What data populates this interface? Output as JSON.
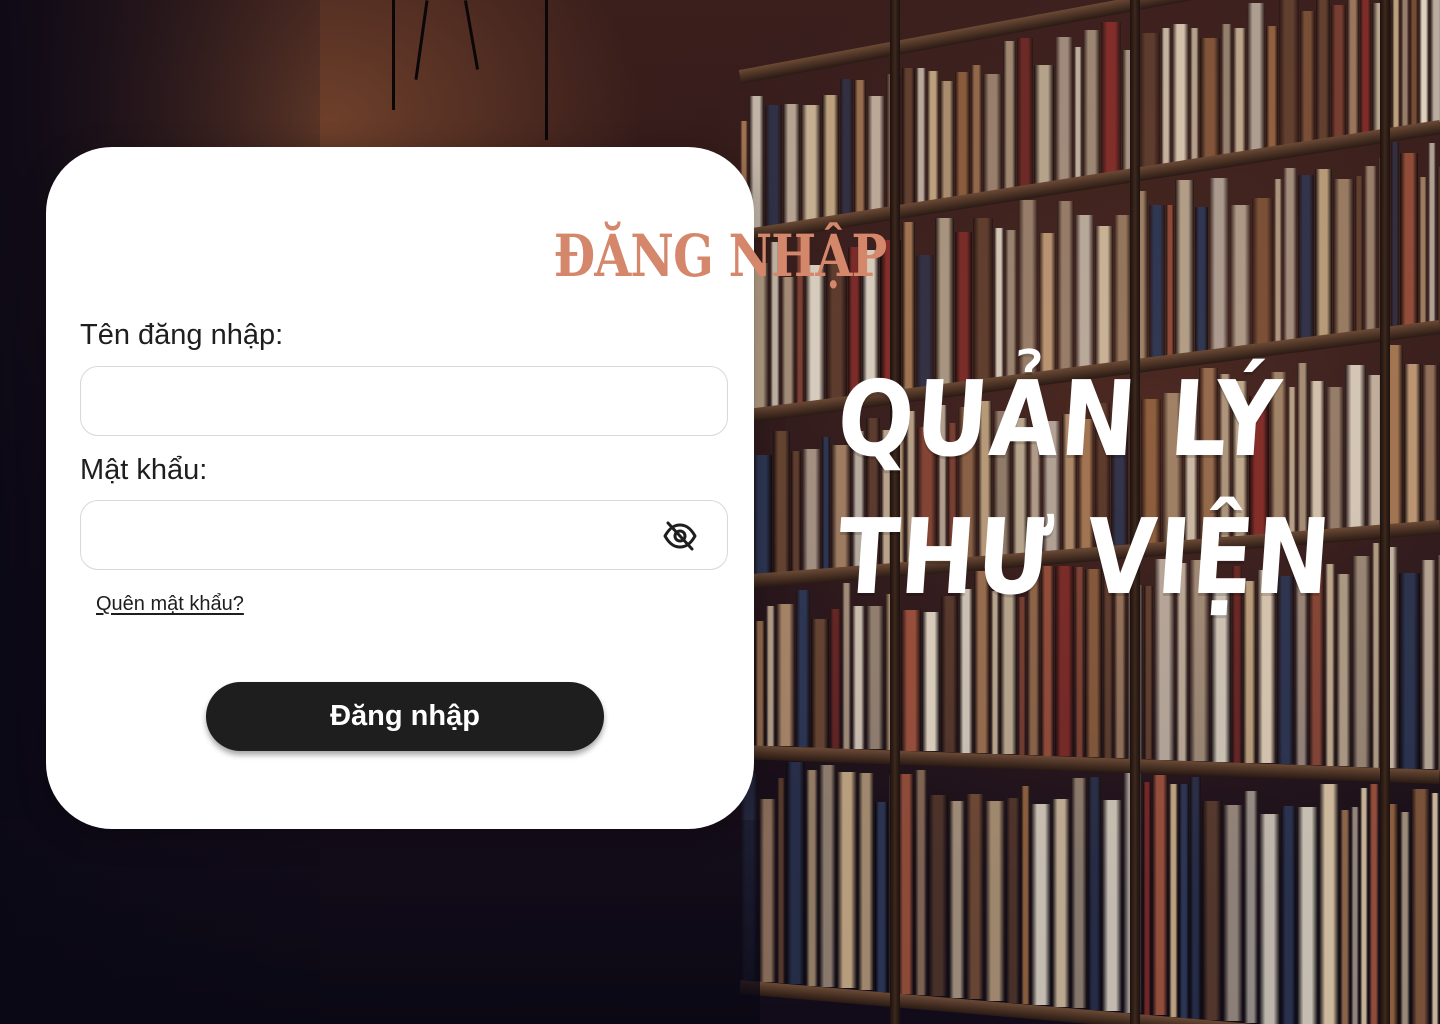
{
  "login": {
    "title": "ĐĂNG NHẬP",
    "username_label": "Tên đăng nhập:",
    "username_value": "",
    "password_label": "Mật khẩu:",
    "password_value": "",
    "toggle_icon": "eye-slash-icon",
    "forgot_password": "Quên mật khẩu?",
    "submit_label": "Đăng nhập"
  },
  "hero": {
    "line1": "QUẢN LÝ",
    "line2": "THƯ VIỆN"
  },
  "colors": {
    "title_accent": "#d4876a",
    "button_bg": "#1e1e1e",
    "card_bg": "#ffffff",
    "hero_text": "#ffffff"
  }
}
